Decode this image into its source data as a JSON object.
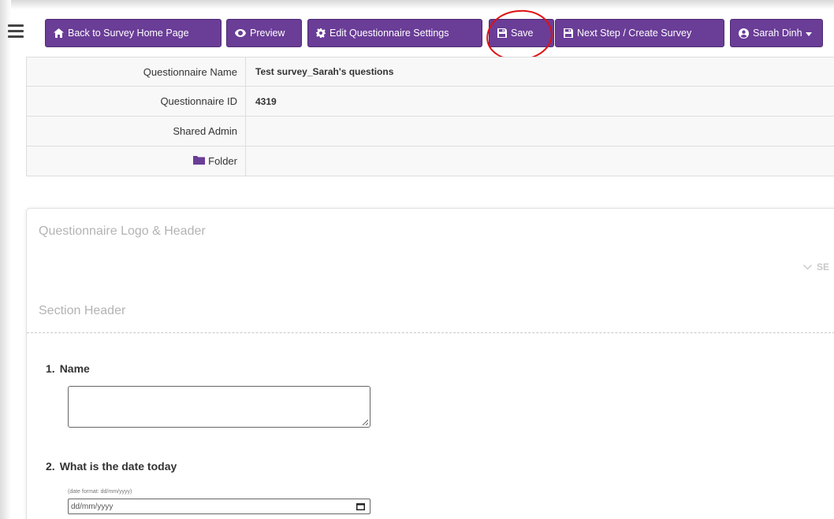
{
  "toolbar": {
    "back_label": "Back to Survey Home Page",
    "preview_label": "Preview",
    "edit_settings_label": "Edit Questionnaire Settings",
    "save_label": "Save",
    "next_label": "Next Step / Create Survey",
    "user_label": "Sarah Dinh",
    "accent_color": "#6a3d97",
    "annotation_color": "#e01010"
  },
  "info": {
    "rows": [
      {
        "label": "Questionnaire Name",
        "value": "Test survey_Sarah's questions"
      },
      {
        "label": "Questionnaire ID",
        "value": "4319"
      },
      {
        "label": "Shared Admin",
        "value": ""
      },
      {
        "label": "Folder",
        "value": ""
      }
    ]
  },
  "panel": {
    "logo_header": "Questionnaire Logo & Header",
    "chevron_label": "SE",
    "section_header": "Section Header",
    "questions": [
      {
        "number": "1.",
        "text": "Name"
      },
      {
        "number": "2.",
        "text": "What is the date today"
      }
    ],
    "date_hint": "(date format: dd/mm/yyyy)",
    "date_placeholder": "dd/mm/yyyy"
  }
}
